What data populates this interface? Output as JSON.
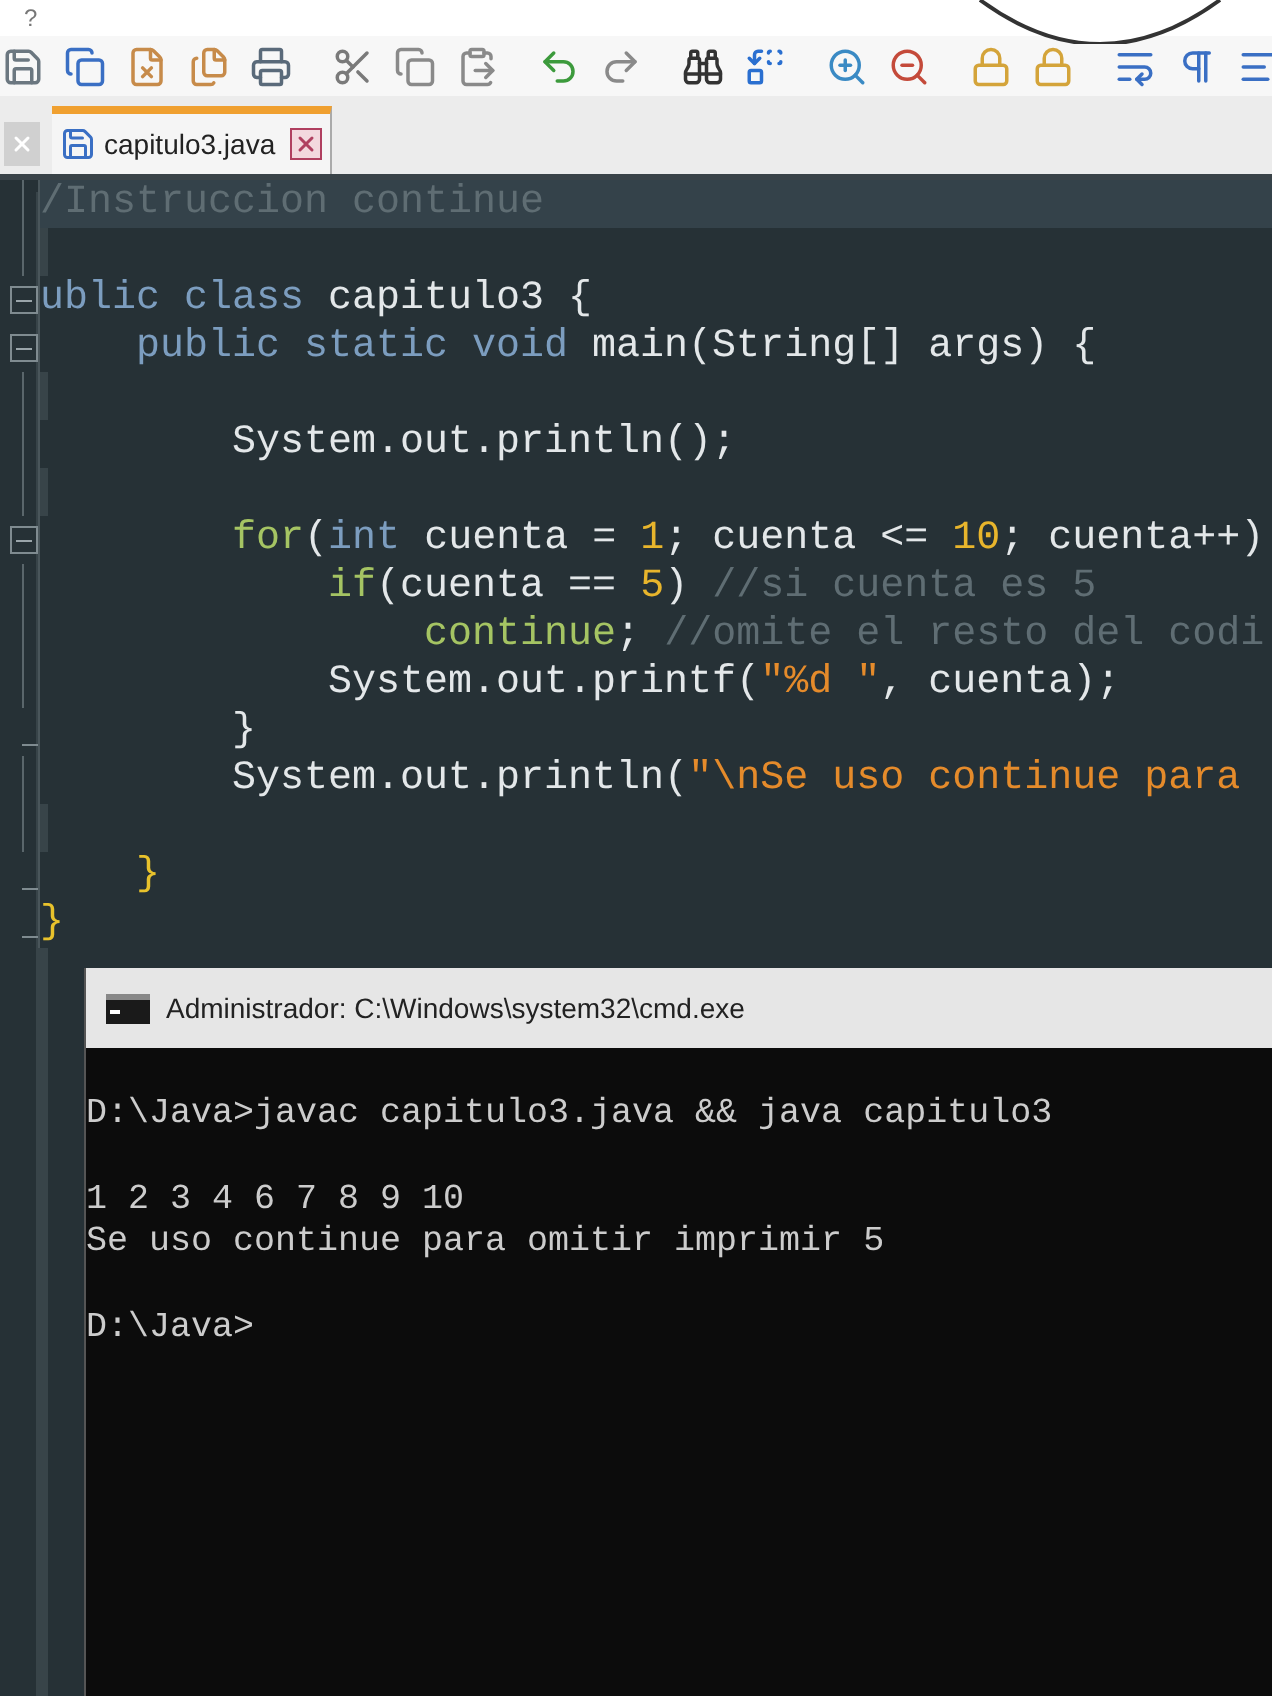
{
  "menu": {
    "items": [
      "?"
    ]
  },
  "tabs": [
    {
      "label": "capitulo3.java",
      "selected": true
    }
  ],
  "editor": {
    "lines": [
      {
        "current": true,
        "kind": "plain",
        "tokens": [
          {
            "kind": "comment",
            "text": "/Instruccion continue"
          }
        ]
      },
      {
        "kind": "blank"
      },
      {
        "current": false,
        "kind": "fold_start",
        "tokens": [
          {
            "kind": "keyword",
            "text": "ublic class "
          },
          {
            "kind": "plain",
            "text": "capitulo3 {"
          }
        ]
      },
      {
        "current": false,
        "kind": "fold_start",
        "tokens": [
          {
            "kind": "keyword",
            "text": "    public static void "
          },
          {
            "kind": "plain",
            "text": "main(String[] args) {"
          }
        ]
      },
      {
        "kind": "blank"
      },
      {
        "current": false,
        "kind": "plain",
        "tokens": [
          {
            "kind": "plain",
            "text": "        System.out.println();"
          }
        ]
      },
      {
        "kind": "blank"
      },
      {
        "current": false,
        "kind": "fold_start",
        "tokens": [
          {
            "kind": "control",
            "text": "        for"
          },
          {
            "kind": "plain",
            "text": "("
          },
          {
            "kind": "keyword",
            "text": "int"
          },
          {
            "kind": "plain",
            "text": " cuenta = "
          },
          {
            "kind": "number",
            "text": "1"
          },
          {
            "kind": "plain",
            "text": "; cuenta <= "
          },
          {
            "kind": "number",
            "text": "10"
          },
          {
            "kind": "plain",
            "text": "; cuenta++)"
          }
        ]
      },
      {
        "current": false,
        "kind": "plain",
        "tokens": [
          {
            "kind": "control",
            "text": "            if"
          },
          {
            "kind": "plain",
            "text": "(cuenta == "
          },
          {
            "kind": "number",
            "text": "5"
          },
          {
            "kind": "plain",
            "text": ") "
          },
          {
            "kind": "comment",
            "text": "//si cuenta es 5"
          }
        ]
      },
      {
        "current": false,
        "kind": "plain",
        "tokens": [
          {
            "kind": "control",
            "text": "                continue"
          },
          {
            "kind": "plain",
            "text": "; "
          },
          {
            "kind": "comment",
            "text": "//omite el resto del codi"
          }
        ]
      },
      {
        "current": false,
        "kind": "plain",
        "tokens": [
          {
            "kind": "plain",
            "text": "            System.out.printf("
          },
          {
            "kind": "string",
            "text": "\"%d \""
          },
          {
            "kind": "plain",
            "text": ", cuenta);"
          }
        ]
      },
      {
        "current": false,
        "kind": "fold_end",
        "tokens": [
          {
            "kind": "plain",
            "text": "        }"
          }
        ]
      },
      {
        "current": false,
        "kind": "plain",
        "tokens": [
          {
            "kind": "plain",
            "text": "        System.out.println("
          },
          {
            "kind": "string",
            "text": "\"\\nSe uso continue para"
          }
        ]
      },
      {
        "kind": "blank"
      },
      {
        "current": false,
        "kind": "fold_end",
        "tokens": [
          {
            "kind": "brace",
            "text": "    }"
          }
        ]
      },
      {
        "current": false,
        "kind": "fold_end",
        "tokens": [
          {
            "kind": "brace",
            "text": "}"
          }
        ]
      }
    ]
  },
  "console": {
    "title": "Administrador: C:\\Windows\\system32\\cmd.exe",
    "lines": [
      {
        "kind": "blank"
      },
      {
        "kind": "text",
        "text": "D:\\Java>javac capitulo3.java && java capitulo3"
      },
      {
        "kind": "blank"
      },
      {
        "kind": "text",
        "text": "1 2 3 4 6 7 8 9 10"
      },
      {
        "kind": "text",
        "text": "Se uso continue para omitir imprimir 5"
      },
      {
        "kind": "blank"
      },
      {
        "kind": "text",
        "text": "D:\\Java>"
      }
    ]
  }
}
